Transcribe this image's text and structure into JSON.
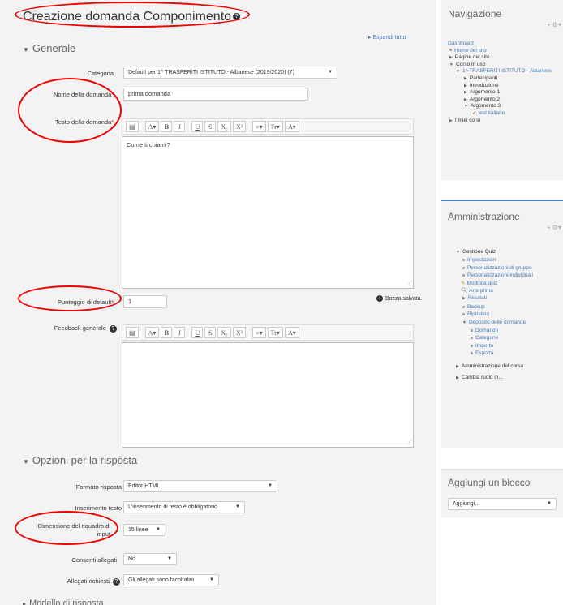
{
  "page_title": "Creazione domanda Componimento",
  "expand_all": "Espandi tutto",
  "sections": {
    "general": "Generale",
    "response_options": "Opzioni per la risposta",
    "response_template": "Modello di risposta"
  },
  "form": {
    "category": {
      "label": "Categoria",
      "value": "Default per 1^ TRASFERITI ISTITUTO - Albanese (2019/2020) (7)"
    },
    "question_name": {
      "label": "Nome della domanda",
      "value": "prima domanda"
    },
    "question_text": {
      "label": "Testo della domanda",
      "value": "Come ti chiami?"
    },
    "default_mark": {
      "label": "Punteggio di default",
      "value": "1"
    },
    "general_feedback": {
      "label": "Feedback generale"
    },
    "draft_status": "Bozza salvata.",
    "response_format": {
      "label": "Formato risposta",
      "value": "Editor HTML"
    },
    "require_text": {
      "label": "Inserimento testo",
      "value": "L'inserimento di testo è obbligatorio"
    },
    "input_box_size": {
      "label": "Dimensione del riquadro di input",
      "value": "15 linee"
    },
    "allow_attachments": {
      "label": "Consenti allegati",
      "value": "No"
    },
    "required_attachments": {
      "label": "Allegati richiesti",
      "value": "Gli allegati sono facoltativi"
    }
  },
  "toolbar_icons": [
    "paragraph-icon",
    "text-style-icon",
    "bold-icon",
    "italic-icon",
    "underline-icon",
    "strikethrough-icon",
    "subscript-icon",
    "superscript-icon",
    "list-icon",
    "format-icon",
    "text-color-icon"
  ],
  "toolbar_labels": {
    "b": "B",
    "i": "I",
    "u": "U",
    "s": "S",
    "sub": "X₂",
    "sup": "X²",
    "fmt": "Tr▾",
    "color": "A▾",
    "style": "A▾",
    "list": "≡▾"
  },
  "navigation": {
    "title": "Navigazione",
    "items": {
      "dashboard": "Dashboard",
      "home": "Home del sito",
      "pages": "Pagine del sito",
      "course": "Corso in uso",
      "course_name": "1^ TRASFERITI ISTITUTO - Albanese",
      "participants": "Partecipanti",
      "intro": "Introduzione",
      "arg1": "Argomento 1",
      "arg2": "Argomento 2",
      "arg3": "Argomento 3",
      "quiz": "test italiano",
      "my_courses": "I miei corsi"
    }
  },
  "administration": {
    "title": "Amministrazione",
    "items": {
      "quiz_admin": "Gestione Quiz",
      "settings": "Impostazioni",
      "group_overrides": "Personalizzazioni di gruppo",
      "user_overrides": "Personalizzazioni individuali",
      "edit_quiz": "Modifica quiz",
      "preview": "Anteprima",
      "results": "Risultati",
      "backup": "Backup",
      "restore": "Ripristino",
      "question_bank": "Deposito delle domande",
      "questions": "Domande",
      "categories": "Categorie",
      "import": "Importa",
      "export": "Esporta",
      "course_admin": "Amministrazione del corso",
      "switch_role": "Cambia ruolo in..."
    }
  },
  "add_block": {
    "title": "Aggiungi un blocco",
    "select": "Aggiungi..."
  },
  "colors": {
    "annotation": "#e00000",
    "link": "#4a7ab8",
    "required": "#cc0000"
  }
}
